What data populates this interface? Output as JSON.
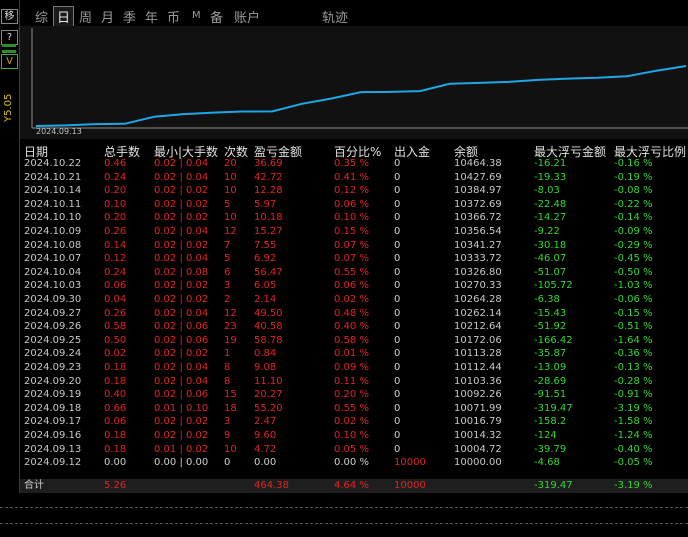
{
  "side": {
    "top_char": "移",
    "help": "?",
    "arrow": "V",
    "price_label": "Y5.05"
  },
  "tabs": [
    {
      "label": "综",
      "active": false
    },
    {
      "label": "日",
      "active": true
    },
    {
      "label": "周",
      "active": false
    },
    {
      "label": "月",
      "active": false
    },
    {
      "label": "季",
      "active": false
    },
    {
      "label": "年",
      "active": false
    },
    {
      "label": "币",
      "active": false
    },
    {
      "label": "M",
      "active": false
    },
    {
      "label": "备",
      "active": false
    },
    {
      "label": "账户",
      "active": false
    },
    {
      "label": "轨迹",
      "active": false
    }
  ],
  "chart_data": {
    "type": "line",
    "x_tick": "2024.09.13",
    "color": "#1ea7e8",
    "x": [
      "2024.09.12",
      "2024.09.13",
      "2024.09.16",
      "2024.09.17",
      "2024.09.18",
      "2024.09.19",
      "2024.09.20",
      "2024.09.23",
      "2024.09.24",
      "2024.09.25",
      "2024.09.26",
      "2024.09.27",
      "2024.09.30",
      "2024.10.03",
      "2024.10.04",
      "2024.10.07",
      "2024.10.08",
      "2024.10.09",
      "2024.10.10",
      "2024.10.11",
      "2024.10.14",
      "2024.10.21",
      "2024.10.22"
    ],
    "values": [
      10000.0,
      10004.72,
      10014.32,
      10016.79,
      10071.99,
      10092.26,
      10103.36,
      10112.44,
      10113.28,
      10172.06,
      10212.64,
      10262.14,
      10264.28,
      10270.33,
      10326.8,
      10333.72,
      10341.27,
      10356.54,
      10366.72,
      10372.69,
      10384.97,
      10427.69,
      10464.38
    ]
  },
  "table": {
    "headers": {
      "date": "日期",
      "total": "总手数",
      "minmax": "最小|大手数",
      "count": "次数",
      "pl": "盈亏金额",
      "pct": "百分比%",
      "io": "出入金",
      "balance": "余额",
      "float_amt": "最大浮亏金额",
      "float_pct": "最大浮亏比例"
    },
    "rows": [
      {
        "date": "2024.10.22",
        "total": "0.46",
        "minmax": "0.02 | 0.04",
        "count": "20",
        "pl": "36.69",
        "pct": "0.35 %",
        "io": "0",
        "balance": "10464.38",
        "fa": "-16.21",
        "fr": "-0.16 %"
      },
      {
        "date": "2024.10.21",
        "total": "0.24",
        "minmax": "0.02 | 0.04",
        "count": "10",
        "pl": "42.72",
        "pct": "0.41 %",
        "io": "0",
        "balance": "10427.69",
        "fa": "-19.33",
        "fr": "-0.19 %"
      },
      {
        "date": "2024.10.14",
        "total": "0.20",
        "minmax": "0.02 | 0.02",
        "count": "10",
        "pl": "12.28",
        "pct": "0.12 %",
        "io": "0",
        "balance": "10384.97",
        "fa": "-8.03",
        "fr": "-0.08 %"
      },
      {
        "date": "2024.10.11",
        "total": "0.10",
        "minmax": "0.02 | 0.02",
        "count": "5",
        "pl": "5.97",
        "pct": "0.06 %",
        "io": "0",
        "balance": "10372.69",
        "fa": "-22.48",
        "fr": "-0.22 %"
      },
      {
        "date": "2024.10.10",
        "total": "0.20",
        "minmax": "0.02 | 0.02",
        "count": "10",
        "pl": "10.18",
        "pct": "0.10 %",
        "io": "0",
        "balance": "10366.72",
        "fa": "-14.27",
        "fr": "-0.14 %"
      },
      {
        "date": "2024.10.09",
        "total": "0.26",
        "minmax": "0.02 | 0.04",
        "count": "12",
        "pl": "15.27",
        "pct": "0.15 %",
        "io": "0",
        "balance": "10356.54",
        "fa": "-9.22",
        "fr": "-0.09 %"
      },
      {
        "date": "2024.10.08",
        "total": "0.14",
        "minmax": "0.02 | 0.02",
        "count": "7",
        "pl": "7.55",
        "pct": "0.07 %",
        "io": "0",
        "balance": "10341.27",
        "fa": "-30.18",
        "fr": "-0.29 %"
      },
      {
        "date": "2024.10.07",
        "total": "0.12",
        "minmax": "0.02 | 0.04",
        "count": "5",
        "pl": "6.92",
        "pct": "0.07 %",
        "io": "0",
        "balance": "10333.72",
        "fa": "-46.07",
        "fr": "-0.45 %"
      },
      {
        "date": "2024.10.04",
        "total": "0.24",
        "minmax": "0.02 | 0.08",
        "count": "6",
        "pl": "56.47",
        "pct": "0.55 %",
        "io": "0",
        "balance": "10326.80",
        "fa": "-51.07",
        "fr": "-0.50 %"
      },
      {
        "date": "2024.10.03",
        "total": "0.06",
        "minmax": "0.02 | 0.02",
        "count": "3",
        "pl": "6.05",
        "pct": "0.06 %",
        "io": "0",
        "balance": "10270.33",
        "fa": "-105.72",
        "fr": "-1.03 %"
      },
      {
        "date": "2024.09.30",
        "total": "0.04",
        "minmax": "0.02 | 0.02",
        "count": "2",
        "pl": "2.14",
        "pct": "0.02 %",
        "io": "0",
        "balance": "10264.28",
        "fa": "-6.38",
        "fr": "-0.06 %"
      },
      {
        "date": "2024.09.27",
        "total": "0.26",
        "minmax": "0.02 | 0.04",
        "count": "12",
        "pl": "49.50",
        "pct": "0.48 %",
        "io": "0",
        "balance": "10262.14",
        "fa": "-15.43",
        "fr": "-0.15 %"
      },
      {
        "date": "2024.09.26",
        "total": "0.58",
        "minmax": "0.02 | 0.06",
        "count": "23",
        "pl": "40.58",
        "pct": "0.40 %",
        "io": "0",
        "balance": "10212.64",
        "fa": "-51.92",
        "fr": "-0.51 %"
      },
      {
        "date": "2024.09.25",
        "total": "0.50",
        "minmax": "0.02 | 0.06",
        "count": "19",
        "pl": "58.78",
        "pct": "0.58 %",
        "io": "0",
        "balance": "10172.06",
        "fa": "-166.42",
        "fr": "-1.64 %"
      },
      {
        "date": "2024.09.24",
        "total": "0.02",
        "minmax": "0.02 | 0.02",
        "count": "1",
        "pl": "0.84",
        "pct": "0.01 %",
        "io": "0",
        "balance": "10113.28",
        "fa": "-35.87",
        "fr": "-0.36 %"
      },
      {
        "date": "2024.09.23",
        "total": "0.18",
        "minmax": "0.02 | 0.04",
        "count": "8",
        "pl": "9.08",
        "pct": "0.09 %",
        "io": "0",
        "balance": "10112.44",
        "fa": "-13.09",
        "fr": "-0.13 %"
      },
      {
        "date": "2024.09.20",
        "total": "0.18",
        "minmax": "0.02 | 0.04",
        "count": "8",
        "pl": "11.10",
        "pct": "0.11 %",
        "io": "0",
        "balance": "10103.36",
        "fa": "-28.69",
        "fr": "-0.28 %"
      },
      {
        "date": "2024.09.19",
        "total": "0.40",
        "minmax": "0.02 | 0.06",
        "count": "15",
        "pl": "20.27",
        "pct": "0.20 %",
        "io": "0",
        "balance": "10092.26",
        "fa": "-91.51",
        "fr": "-0.91 %"
      },
      {
        "date": "2024.09.18",
        "total": "0.66",
        "minmax": "0.01 | 0.10",
        "count": "18",
        "pl": "55.20",
        "pct": "0.55 %",
        "io": "0",
        "balance": "10071.99",
        "fa": "-319.47",
        "fr": "-3.19 %"
      },
      {
        "date": "2024.09.17",
        "total": "0.06",
        "minmax": "0.02 | 0.02",
        "count": "3",
        "pl": "2.47",
        "pct": "0.02 %",
        "io": "0",
        "balance": "10016.79",
        "fa": "-158.2",
        "fr": "-1.58 %"
      },
      {
        "date": "2024.09.16",
        "total": "0.18",
        "minmax": "0.02 | 0.02",
        "count": "9",
        "pl": "9.60",
        "pct": "0.10 %",
        "io": "0",
        "balance": "10014.32",
        "fa": "-124",
        "fr": "-1.24 %"
      },
      {
        "date": "2024.09.13",
        "total": "0.18",
        "minmax": "0.01 | 0.02",
        "count": "10",
        "pl": "4.72",
        "pct": "0.05 %",
        "io": "0",
        "balance": "10004.72",
        "fa": "-39.79",
        "fr": "-0.40 %"
      },
      {
        "date": "2024.09.12",
        "total": "0.00",
        "minmax": "0.00 | 0.00",
        "count": "0",
        "pl": "0.00",
        "pct": "0.00 %",
        "io": "10000",
        "balance": "10000.00",
        "fa": "-4.68",
        "fr": "-0.05 %"
      }
    ],
    "summary": {
      "label": "合计",
      "total": "5.26",
      "pl": "464.38",
      "pct": "4.64 %",
      "io": "10000",
      "fa": "-319.47",
      "fr": "-3.19 %"
    }
  }
}
